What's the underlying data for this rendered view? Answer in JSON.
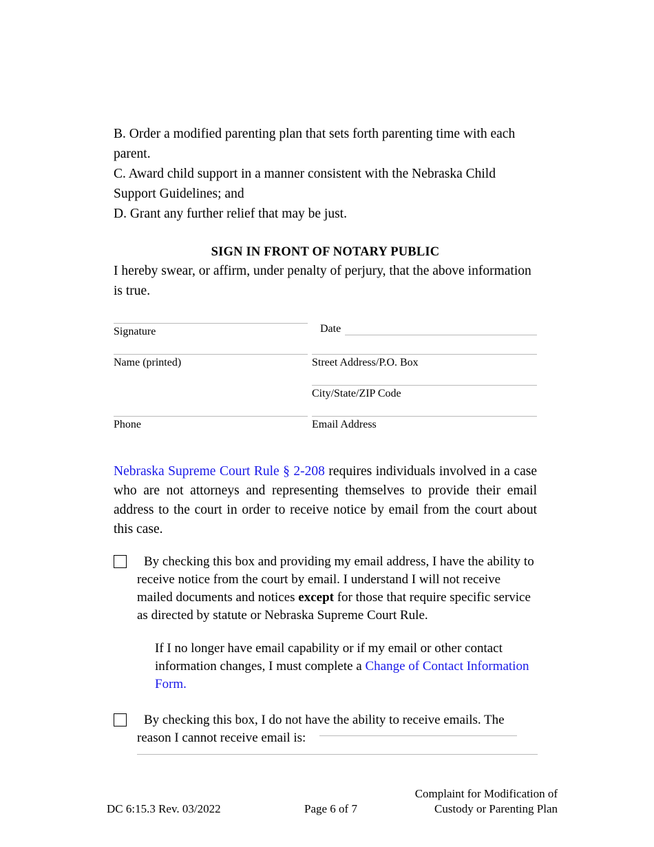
{
  "document": {
    "relief_items": [
      "B.  Order a modified parenting plan that sets forth parenting time with each parent.",
      "C.  Award child support in a manner consistent with the Nebraska Child Support Guidelines; and",
      "D.  Grant any further relief that may be just."
    ],
    "notary_heading": "SIGN IN FRONT OF NOTARY PUBLIC",
    "swear_statement": "I hereby swear, or affirm, under penalty of perjury, that the above information is true.",
    "form_fields": {
      "date_label": "Date",
      "signature_label": "Signature",
      "name_printed_label": "Name (printed)",
      "street_address_label": "Street Address/P.O. Box",
      "city_state_zip_label": "City/State/ZIP Code",
      "phone_label": "Phone",
      "email_address_label": "Email Address"
    },
    "rule_paragraph": {
      "link_text": "Nebraska Supreme Court Rule § 2-208",
      "body_text": " requires individuals involved in a case who are not attorneys and representing themselves to provide their email address to the court in order to receive notice by email from the court about this case."
    },
    "checkbox_one": {
      "text_part_1": "By checking this box and providing my email address, I have the ability to receive notice from the court by email. I understand I will not receive mailed documents and notices ",
      "bold_word": "except",
      "text_part_2": " for those that require specific service as directed by statute or Nebraska Supreme Court Rule."
    },
    "change_of_contact_paragraph": {
      "text_before": "If I no longer have email capability or if my email or other contact information changes, I must complete a ",
      "link_text": "Change of Contact Information Form."
    },
    "checkbox_two": {
      "text": "By checking this box, I do not have the ability to receive emails. The reason I cannot receive email is:"
    },
    "footer": {
      "form_number": "DC 6:15.3  Rev. 03/2022",
      "page_number": "Page 6 of 7",
      "title_line_1": "Complaint for Modification of",
      "title_line_2": "Custody or Parenting Plan"
    },
    "colors": {
      "link": "#1a1ae8",
      "text": "#000000",
      "rule_line": "#b9b9b9",
      "page_background": "#ffffff"
    }
  }
}
